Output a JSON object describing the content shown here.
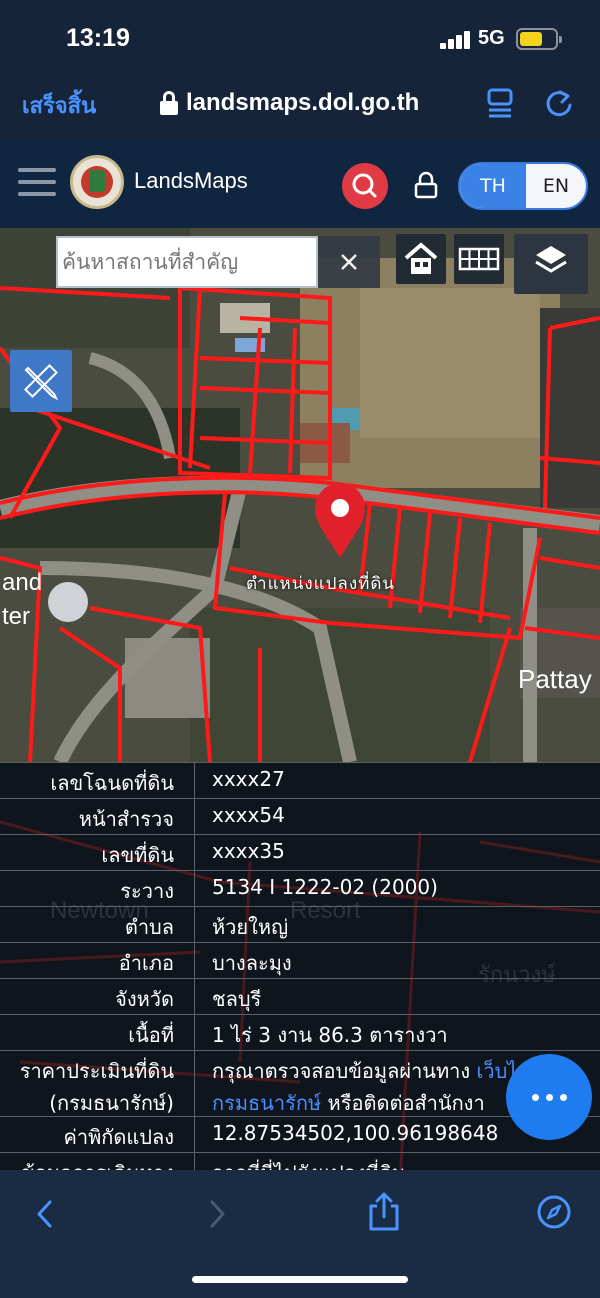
{
  "status": {
    "time": "13:19",
    "network": "5G"
  },
  "browser": {
    "done_label": "เสร็จสิ้น",
    "url": "landsmaps.dol.go.th"
  },
  "app": {
    "brand": "LandsMaps",
    "lang": {
      "th": "TH",
      "en": "EN",
      "active": "TH"
    }
  },
  "map": {
    "search_placeholder": "ค้นหาสถานที่สำคัญ",
    "parcel_label": "ตำแหน่งแปลงที่ดิน",
    "background_text": [
      "and",
      "ter",
      "Pattay"
    ]
  },
  "info": {
    "rows": [
      {
        "key": "เลขโฉนดที่ดิน",
        "value": "xxxx27"
      },
      {
        "key": "หน้าสำรวจ",
        "value": "xxxx54"
      },
      {
        "key": "เลขที่ดิน",
        "value": "xxxx35"
      },
      {
        "key": "ระวาง",
        "value": "5134 I 1222-02 (2000)"
      },
      {
        "key": "ตำบล",
        "value": "ห้วยใหญ่"
      },
      {
        "key": "อำเภอ",
        "value": "บางละมุง"
      },
      {
        "key": "จังหวัด",
        "value": "ชลบุรี"
      },
      {
        "key": "เนื้อที่",
        "value": "1 ไร่ 3 งาน 86.3 ตารางวา"
      }
    ],
    "appraisal": {
      "key_line1": "ราคาประเมินที่ดิน",
      "key_line2": "(กรมธนารักษ์)",
      "text1": "กรุณาตรวจสอบข้อมูลผ่านทาง ",
      "link1": "เว็บไซต์",
      "link2": "กรมธนารักษ์",
      "text2": " หรือติดต่อสำนักงา"
    },
    "coords": {
      "key": "ค่าพิกัดแปลง",
      "value": "12.87534502,100.96198648"
    },
    "travel": {
      "key": "ข้อมูลการเดินทาง",
      "value": "จากที่นี่ไปยังแปลงที่ดิน"
    },
    "background_text": [
      "Newtown",
      "Resort",
      "รักนวงษ์"
    ]
  },
  "colors": {
    "accent": "#3a82e4",
    "parcel_line": "#ff1a1a",
    "pin": "#e0202a",
    "link": "#4c8dff"
  }
}
